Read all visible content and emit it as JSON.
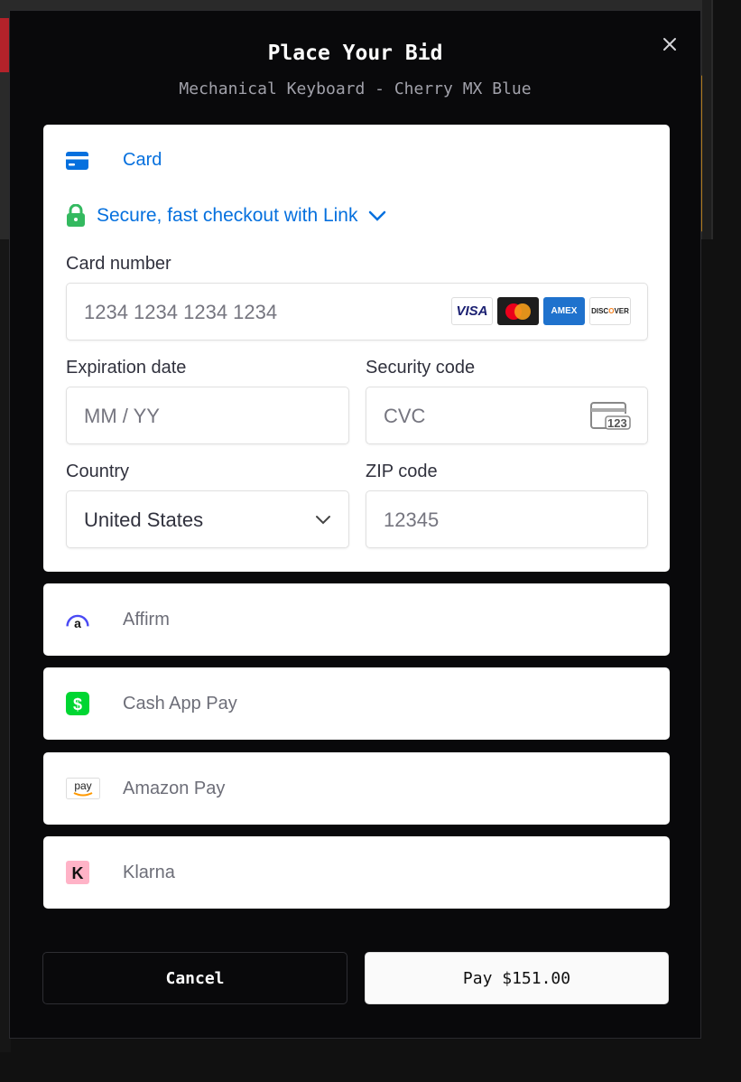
{
  "modal": {
    "title": "Place Your Bid",
    "subtitle": "Mechanical Keyboard - Cherry MX Blue"
  },
  "card": {
    "tab_label": "Card",
    "link_text": "Secure, fast checkout with Link",
    "card_number_label": "Card number",
    "card_number_placeholder": "1234 1234 1234 1234",
    "brands": [
      "VISA",
      "Mastercard",
      "AMEX",
      "DISCOVER"
    ],
    "expiration_label": "Expiration date",
    "expiration_placeholder": "MM / YY",
    "security_label": "Security code",
    "security_placeholder": "CVC",
    "cvc_icon_text": "123",
    "country_label": "Country",
    "country_value": "United States",
    "zip_label": "ZIP code",
    "zip_placeholder": "12345"
  },
  "methods": [
    {
      "label": "Affirm",
      "icon": "affirm-icon"
    },
    {
      "label": "Cash App Pay",
      "icon": "cash-app-icon"
    },
    {
      "label": "Amazon Pay",
      "icon": "amazon-pay-icon"
    },
    {
      "label": "Klarna",
      "icon": "klarna-icon"
    }
  ],
  "buttons": {
    "cancel": "Cancel",
    "pay": "Pay $151.00"
  },
  "colors": {
    "link_blue": "#0570de",
    "lock_green": "#33b95f",
    "modal_bg": "#09090b"
  }
}
